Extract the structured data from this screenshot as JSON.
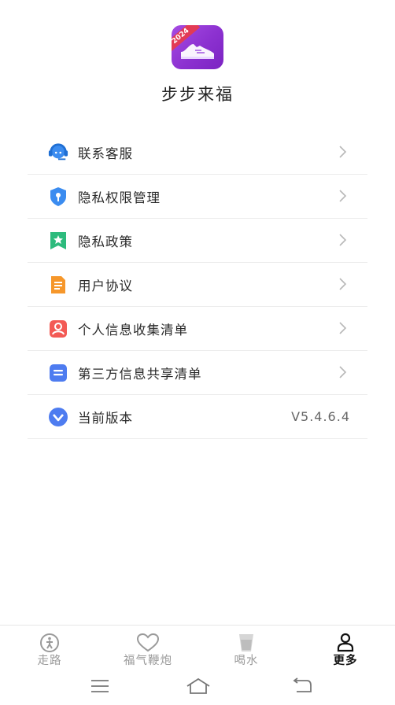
{
  "app": {
    "name": "步步来福",
    "logo_badge": "2024"
  },
  "menu": [
    {
      "label": "联系客服",
      "icon": "customer-service-icon",
      "color": "#3b8cf0"
    },
    {
      "label": "隐私权限管理",
      "icon": "privacy-shield-icon",
      "color": "#3b8cf0"
    },
    {
      "label": "隐私政策",
      "icon": "policy-bookmark-icon",
      "color": "#2dbb7d"
    },
    {
      "label": "用户协议",
      "icon": "document-icon",
      "color": "#f6972b"
    },
    {
      "label": "个人信息收集清单",
      "icon": "person-card-icon",
      "color": "#f35a55"
    },
    {
      "label": "第三方信息共享清单",
      "icon": "list-card-icon",
      "color": "#4e7cf0"
    },
    {
      "label": "当前版本",
      "icon": "version-icon",
      "color": "#4e7cf0",
      "value": "V5.4.6.4"
    }
  ],
  "tabs": [
    {
      "label": "走路",
      "icon": "walk-icon",
      "active": false
    },
    {
      "label": "福气鞭炮",
      "icon": "heart-icon",
      "active": false
    },
    {
      "label": "喝水",
      "icon": "water-cup-icon",
      "active": false
    },
    {
      "label": "更多",
      "icon": "profile-icon",
      "active": true
    }
  ],
  "system_nav": [
    "menu-icon",
    "home-icon",
    "back-icon"
  ],
  "colors": {
    "logo": "#8c31d0",
    "active_tab": "#111111",
    "inactive_tab": "#9a9a9a"
  }
}
